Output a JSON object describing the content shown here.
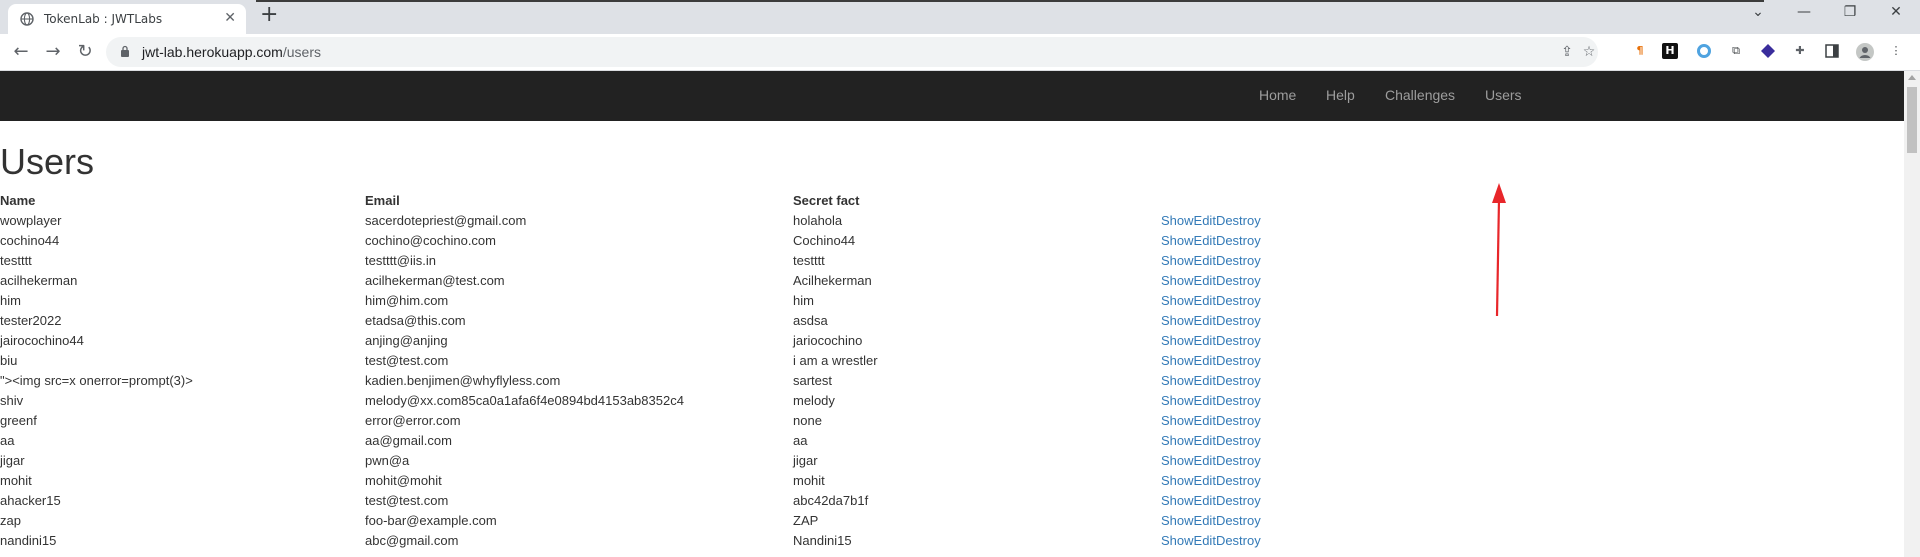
{
  "browser": {
    "tab_title": "TokenLab : JWTLabs",
    "tab_close": "✕",
    "new_tab": "+",
    "url_host": "jwt-lab.herokuapp.com",
    "url_path": "/users",
    "win_minimize": "—",
    "win_maximize": "❐",
    "win_close": "✕",
    "tab_search": "⌄"
  },
  "navbar": {
    "links": [
      "Home",
      "Help",
      "Challenges",
      "Users"
    ]
  },
  "page": {
    "title": "Users",
    "headers": [
      "Name",
      "Email",
      "Secret fact"
    ]
  },
  "actions": {
    "show": "Show",
    "edit": "Edit",
    "destroy": "Destroy"
  },
  "users": [
    {
      "name": "wowplayer",
      "email": "sacerdotepriest@gmail.com",
      "secret": "holahola"
    },
    {
      "name": "cochino44",
      "email": "cochino@cochino.com",
      "secret": "Cochino44"
    },
    {
      "name": "testttt",
      "email": "testttt@iis.in",
      "secret": "testttt"
    },
    {
      "name": "acilhekerman",
      "email": "acilhekerman@test.com",
      "secret": "Acilhekerman"
    },
    {
      "name": "him",
      "email": "him@him.com",
      "secret": "him"
    },
    {
      "name": "tester2022",
      "email": "etadsa@this.com",
      "secret": "asdsa"
    },
    {
      "name": "jairocochino44",
      "email": "anjing@anjing",
      "secret": "jariocochino"
    },
    {
      "name": "biu",
      "email": "test@test.com",
      "secret": "i am a wrestler"
    },
    {
      "name": "\"><img src=x onerror=prompt(3)>",
      "email": "kadien.benjimen@whyflyless.com",
      "secret": "sartest"
    },
    {
      "name": "shiv",
      "email": "melody@xx.com85ca0a1afa6f4e0894bd4153ab8352c4",
      "secret": "melody"
    },
    {
      "name": "greenf",
      "email": "error@error.com",
      "secret": "none"
    },
    {
      "name": "aa",
      "email": "aa@gmail.com",
      "secret": "aa"
    },
    {
      "name": "jigar",
      "email": "pwn@a",
      "secret": "jigar"
    },
    {
      "name": "mohit",
      "email": "mohit@mohit",
      "secret": "mohit"
    },
    {
      "name": "ahacker15",
      "email": "test@test.com",
      "secret": "abc42da7b1f"
    },
    {
      "name": "zap",
      "email": "foo-bar@example.com",
      "secret": "ZAP"
    },
    {
      "name": "nandini15",
      "email": "abc@gmail.com",
      "secret": "Nandini15"
    }
  ],
  "colors": {
    "navbar_bg": "#222222",
    "navlink": "#9d9d9d",
    "link": "#337ab7",
    "annotation_arrow": "#e8262a"
  }
}
